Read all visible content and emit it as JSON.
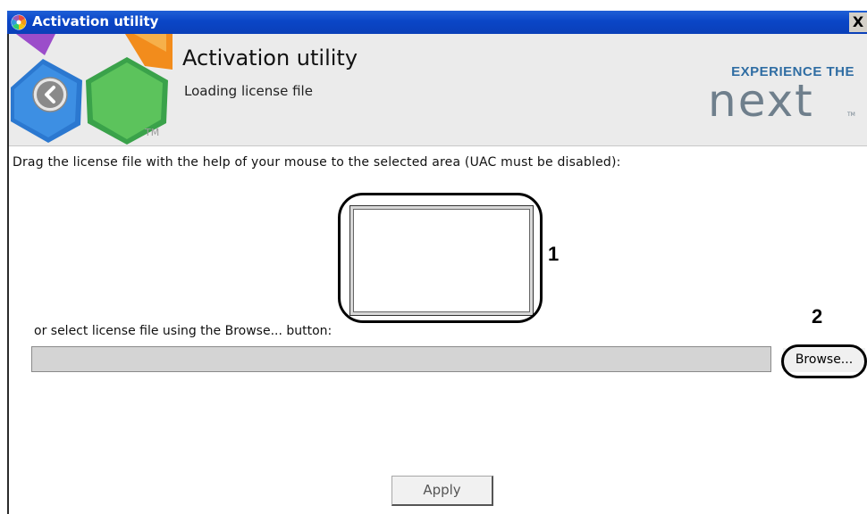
{
  "window": {
    "title": "Activation utility",
    "close_glyph": "X"
  },
  "header": {
    "title": "Activation utility",
    "subtitle": "Loading license file",
    "logo_tm": "TM",
    "brand_tagline": "EXPERIENCE THE",
    "brand_word": "next",
    "brand_tm": "TM"
  },
  "main": {
    "instruction": "Drag the license file with the help of your mouse to the selected area (UAC must be disabled):",
    "browse_hint": "or select license file using the Browse... button:",
    "path_value": "",
    "browse_label": "Browse...",
    "apply_label": "Apply"
  },
  "annotations": {
    "callout_1": "1",
    "callout_2": "2"
  },
  "icons": {
    "app": "app-logo-icon",
    "back": "back-arrow-icon",
    "close": "close-icon"
  },
  "colors": {
    "titlebar": "#0a46c7",
    "header_bg": "#ebebeb",
    "brand_blue": "#2f6da3",
    "brand_gray": "#6f7f8c"
  }
}
